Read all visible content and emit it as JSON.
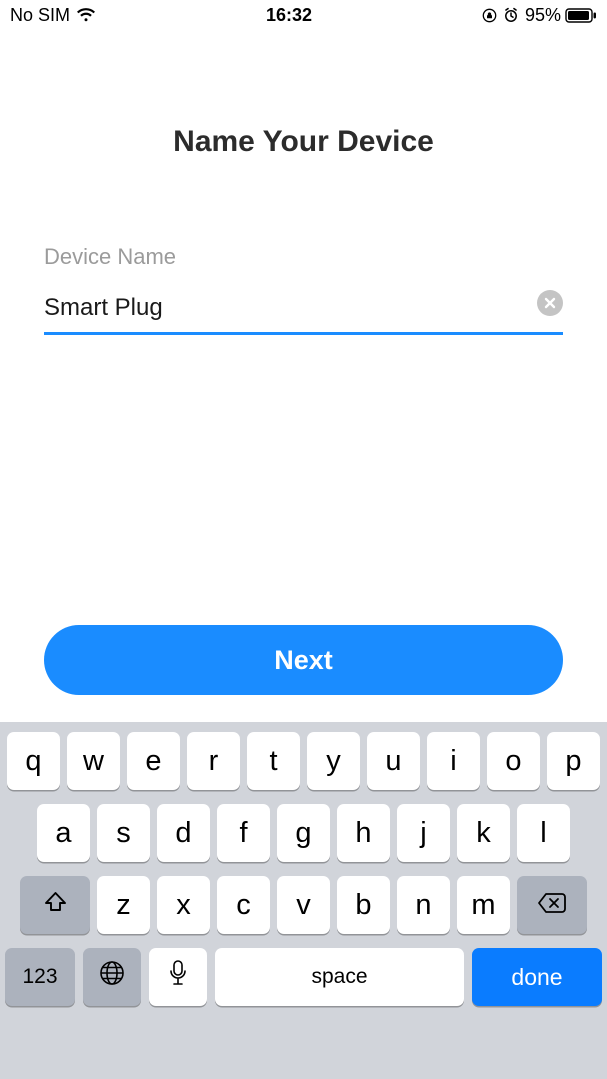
{
  "status": {
    "carrier": "No SIM",
    "time": "16:32",
    "battery_pct": "95%"
  },
  "page": {
    "title": "Name Your Device"
  },
  "field": {
    "label": "Device Name",
    "value": "Smart Plug"
  },
  "buttons": {
    "next": "Next"
  },
  "keyboard": {
    "row1": [
      "q",
      "w",
      "e",
      "r",
      "t",
      "y",
      "u",
      "i",
      "o",
      "p"
    ],
    "row2": [
      "a",
      "s",
      "d",
      "f",
      "g",
      "h",
      "j",
      "k",
      "l"
    ],
    "row3": [
      "z",
      "x",
      "c",
      "v",
      "b",
      "n",
      "m"
    ],
    "numbers": "123",
    "space": "space",
    "done": "done"
  }
}
